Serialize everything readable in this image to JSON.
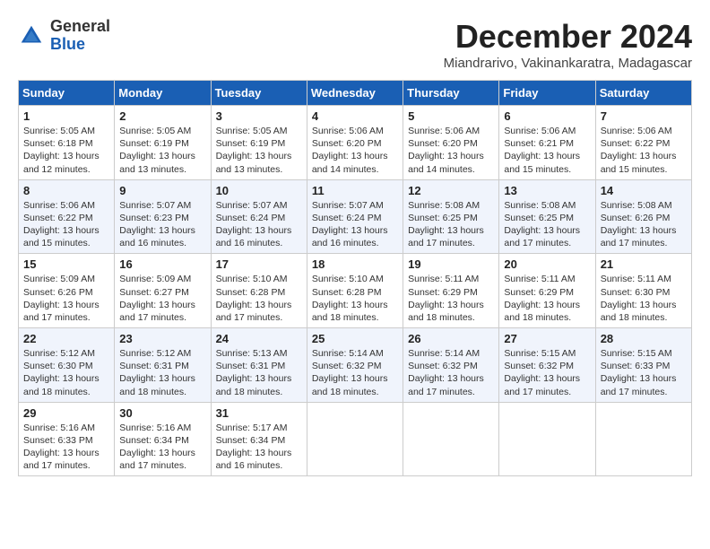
{
  "logo": {
    "general": "General",
    "blue": "Blue"
  },
  "title": "December 2024",
  "subtitle": "Miandrarivo, Vakinankaratra, Madagascar",
  "days_of_week": [
    "Sunday",
    "Monday",
    "Tuesday",
    "Wednesday",
    "Thursday",
    "Friday",
    "Saturday"
  ],
  "weeks": [
    [
      {
        "day": "1",
        "info": "Sunrise: 5:05 AM\nSunset: 6:18 PM\nDaylight: 13 hours\nand 12 minutes."
      },
      {
        "day": "2",
        "info": "Sunrise: 5:05 AM\nSunset: 6:19 PM\nDaylight: 13 hours\nand 13 minutes."
      },
      {
        "day": "3",
        "info": "Sunrise: 5:05 AM\nSunset: 6:19 PM\nDaylight: 13 hours\nand 13 minutes."
      },
      {
        "day": "4",
        "info": "Sunrise: 5:06 AM\nSunset: 6:20 PM\nDaylight: 13 hours\nand 14 minutes."
      },
      {
        "day": "5",
        "info": "Sunrise: 5:06 AM\nSunset: 6:20 PM\nDaylight: 13 hours\nand 14 minutes."
      },
      {
        "day": "6",
        "info": "Sunrise: 5:06 AM\nSunset: 6:21 PM\nDaylight: 13 hours\nand 15 minutes."
      },
      {
        "day": "7",
        "info": "Sunrise: 5:06 AM\nSunset: 6:22 PM\nDaylight: 13 hours\nand 15 minutes."
      }
    ],
    [
      {
        "day": "8",
        "info": "Sunrise: 5:06 AM\nSunset: 6:22 PM\nDaylight: 13 hours\nand 15 minutes."
      },
      {
        "day": "9",
        "info": "Sunrise: 5:07 AM\nSunset: 6:23 PM\nDaylight: 13 hours\nand 16 minutes."
      },
      {
        "day": "10",
        "info": "Sunrise: 5:07 AM\nSunset: 6:24 PM\nDaylight: 13 hours\nand 16 minutes."
      },
      {
        "day": "11",
        "info": "Sunrise: 5:07 AM\nSunset: 6:24 PM\nDaylight: 13 hours\nand 16 minutes."
      },
      {
        "day": "12",
        "info": "Sunrise: 5:08 AM\nSunset: 6:25 PM\nDaylight: 13 hours\nand 17 minutes."
      },
      {
        "day": "13",
        "info": "Sunrise: 5:08 AM\nSunset: 6:25 PM\nDaylight: 13 hours\nand 17 minutes."
      },
      {
        "day": "14",
        "info": "Sunrise: 5:08 AM\nSunset: 6:26 PM\nDaylight: 13 hours\nand 17 minutes."
      }
    ],
    [
      {
        "day": "15",
        "info": "Sunrise: 5:09 AM\nSunset: 6:26 PM\nDaylight: 13 hours\nand 17 minutes."
      },
      {
        "day": "16",
        "info": "Sunrise: 5:09 AM\nSunset: 6:27 PM\nDaylight: 13 hours\nand 17 minutes."
      },
      {
        "day": "17",
        "info": "Sunrise: 5:10 AM\nSunset: 6:28 PM\nDaylight: 13 hours\nand 17 minutes."
      },
      {
        "day": "18",
        "info": "Sunrise: 5:10 AM\nSunset: 6:28 PM\nDaylight: 13 hours\nand 18 minutes."
      },
      {
        "day": "19",
        "info": "Sunrise: 5:11 AM\nSunset: 6:29 PM\nDaylight: 13 hours\nand 18 minutes."
      },
      {
        "day": "20",
        "info": "Sunrise: 5:11 AM\nSunset: 6:29 PM\nDaylight: 13 hours\nand 18 minutes."
      },
      {
        "day": "21",
        "info": "Sunrise: 5:11 AM\nSunset: 6:30 PM\nDaylight: 13 hours\nand 18 minutes."
      }
    ],
    [
      {
        "day": "22",
        "info": "Sunrise: 5:12 AM\nSunset: 6:30 PM\nDaylight: 13 hours\nand 18 minutes."
      },
      {
        "day": "23",
        "info": "Sunrise: 5:12 AM\nSunset: 6:31 PM\nDaylight: 13 hours\nand 18 minutes."
      },
      {
        "day": "24",
        "info": "Sunrise: 5:13 AM\nSunset: 6:31 PM\nDaylight: 13 hours\nand 18 minutes."
      },
      {
        "day": "25",
        "info": "Sunrise: 5:14 AM\nSunset: 6:32 PM\nDaylight: 13 hours\nand 18 minutes."
      },
      {
        "day": "26",
        "info": "Sunrise: 5:14 AM\nSunset: 6:32 PM\nDaylight: 13 hours\nand 17 minutes."
      },
      {
        "day": "27",
        "info": "Sunrise: 5:15 AM\nSunset: 6:32 PM\nDaylight: 13 hours\nand 17 minutes."
      },
      {
        "day": "28",
        "info": "Sunrise: 5:15 AM\nSunset: 6:33 PM\nDaylight: 13 hours\nand 17 minutes."
      }
    ],
    [
      {
        "day": "29",
        "info": "Sunrise: 5:16 AM\nSunset: 6:33 PM\nDaylight: 13 hours\nand 17 minutes."
      },
      {
        "day": "30",
        "info": "Sunrise: 5:16 AM\nSunset: 6:34 PM\nDaylight: 13 hours\nand 17 minutes."
      },
      {
        "day": "31",
        "info": "Sunrise: 5:17 AM\nSunset: 6:34 PM\nDaylight: 13 hours\nand 16 minutes."
      },
      {
        "day": "",
        "info": ""
      },
      {
        "day": "",
        "info": ""
      },
      {
        "day": "",
        "info": ""
      },
      {
        "day": "",
        "info": ""
      }
    ]
  ]
}
